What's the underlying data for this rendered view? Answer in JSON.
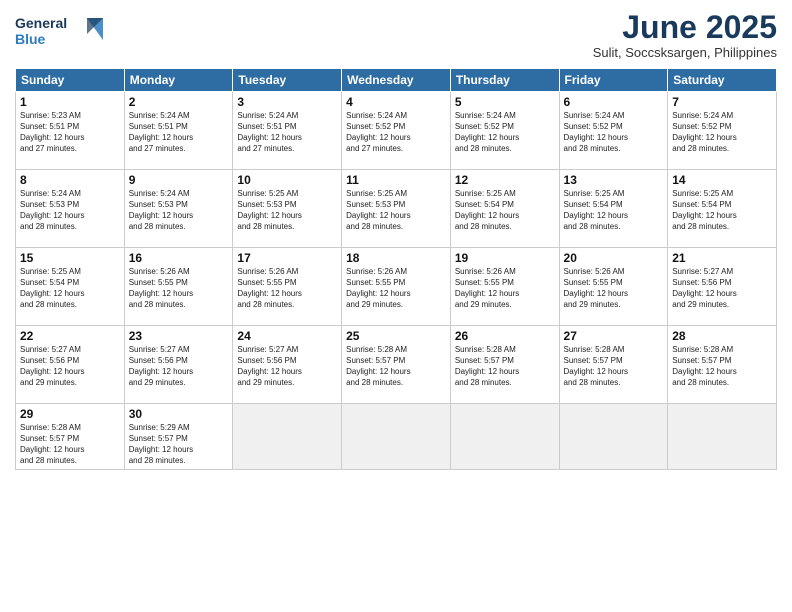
{
  "header": {
    "logo": {
      "line1": "General",
      "line2": "Blue"
    },
    "title": "June 2025",
    "subtitle": "Sulit, Soccsksargen, Philippines"
  },
  "weekdays": [
    "Sunday",
    "Monday",
    "Tuesday",
    "Wednesday",
    "Thursday",
    "Friday",
    "Saturday"
  ],
  "rows": [
    [
      {
        "day": "1",
        "info": "Sunrise: 5:23 AM\nSunset: 5:51 PM\nDaylight: 12 hours\nand 27 minutes."
      },
      {
        "day": "2",
        "info": "Sunrise: 5:24 AM\nSunset: 5:51 PM\nDaylight: 12 hours\nand 27 minutes."
      },
      {
        "day": "3",
        "info": "Sunrise: 5:24 AM\nSunset: 5:51 PM\nDaylight: 12 hours\nand 27 minutes."
      },
      {
        "day": "4",
        "info": "Sunrise: 5:24 AM\nSunset: 5:52 PM\nDaylight: 12 hours\nand 27 minutes."
      },
      {
        "day": "5",
        "info": "Sunrise: 5:24 AM\nSunset: 5:52 PM\nDaylight: 12 hours\nand 28 minutes."
      },
      {
        "day": "6",
        "info": "Sunrise: 5:24 AM\nSunset: 5:52 PM\nDaylight: 12 hours\nand 28 minutes."
      },
      {
        "day": "7",
        "info": "Sunrise: 5:24 AM\nSunset: 5:52 PM\nDaylight: 12 hours\nand 28 minutes."
      }
    ],
    [
      {
        "day": "8",
        "info": "Sunrise: 5:24 AM\nSunset: 5:53 PM\nDaylight: 12 hours\nand 28 minutes."
      },
      {
        "day": "9",
        "info": "Sunrise: 5:24 AM\nSunset: 5:53 PM\nDaylight: 12 hours\nand 28 minutes."
      },
      {
        "day": "10",
        "info": "Sunrise: 5:25 AM\nSunset: 5:53 PM\nDaylight: 12 hours\nand 28 minutes."
      },
      {
        "day": "11",
        "info": "Sunrise: 5:25 AM\nSunset: 5:53 PM\nDaylight: 12 hours\nand 28 minutes."
      },
      {
        "day": "12",
        "info": "Sunrise: 5:25 AM\nSunset: 5:54 PM\nDaylight: 12 hours\nand 28 minutes."
      },
      {
        "day": "13",
        "info": "Sunrise: 5:25 AM\nSunset: 5:54 PM\nDaylight: 12 hours\nand 28 minutes."
      },
      {
        "day": "14",
        "info": "Sunrise: 5:25 AM\nSunset: 5:54 PM\nDaylight: 12 hours\nand 28 minutes."
      }
    ],
    [
      {
        "day": "15",
        "info": "Sunrise: 5:25 AM\nSunset: 5:54 PM\nDaylight: 12 hours\nand 28 minutes."
      },
      {
        "day": "16",
        "info": "Sunrise: 5:26 AM\nSunset: 5:55 PM\nDaylight: 12 hours\nand 28 minutes."
      },
      {
        "day": "17",
        "info": "Sunrise: 5:26 AM\nSunset: 5:55 PM\nDaylight: 12 hours\nand 28 minutes."
      },
      {
        "day": "18",
        "info": "Sunrise: 5:26 AM\nSunset: 5:55 PM\nDaylight: 12 hours\nand 29 minutes."
      },
      {
        "day": "19",
        "info": "Sunrise: 5:26 AM\nSunset: 5:55 PM\nDaylight: 12 hours\nand 29 minutes."
      },
      {
        "day": "20",
        "info": "Sunrise: 5:26 AM\nSunset: 5:55 PM\nDaylight: 12 hours\nand 29 minutes."
      },
      {
        "day": "21",
        "info": "Sunrise: 5:27 AM\nSunset: 5:56 PM\nDaylight: 12 hours\nand 29 minutes."
      }
    ],
    [
      {
        "day": "22",
        "info": "Sunrise: 5:27 AM\nSunset: 5:56 PM\nDaylight: 12 hours\nand 29 minutes."
      },
      {
        "day": "23",
        "info": "Sunrise: 5:27 AM\nSunset: 5:56 PM\nDaylight: 12 hours\nand 29 minutes."
      },
      {
        "day": "24",
        "info": "Sunrise: 5:27 AM\nSunset: 5:56 PM\nDaylight: 12 hours\nand 29 minutes."
      },
      {
        "day": "25",
        "info": "Sunrise: 5:28 AM\nSunset: 5:57 PM\nDaylight: 12 hours\nand 28 minutes."
      },
      {
        "day": "26",
        "info": "Sunrise: 5:28 AM\nSunset: 5:57 PM\nDaylight: 12 hours\nand 28 minutes."
      },
      {
        "day": "27",
        "info": "Sunrise: 5:28 AM\nSunset: 5:57 PM\nDaylight: 12 hours\nand 28 minutes."
      },
      {
        "day": "28",
        "info": "Sunrise: 5:28 AM\nSunset: 5:57 PM\nDaylight: 12 hours\nand 28 minutes."
      }
    ],
    [
      {
        "day": "29",
        "info": "Sunrise: 5:28 AM\nSunset: 5:57 PM\nDaylight: 12 hours\nand 28 minutes."
      },
      {
        "day": "30",
        "info": "Sunrise: 5:29 AM\nSunset: 5:57 PM\nDaylight: 12 hours\nand 28 minutes."
      },
      {
        "day": "",
        "info": ""
      },
      {
        "day": "",
        "info": ""
      },
      {
        "day": "",
        "info": ""
      },
      {
        "day": "",
        "info": ""
      },
      {
        "day": "",
        "info": ""
      }
    ]
  ]
}
